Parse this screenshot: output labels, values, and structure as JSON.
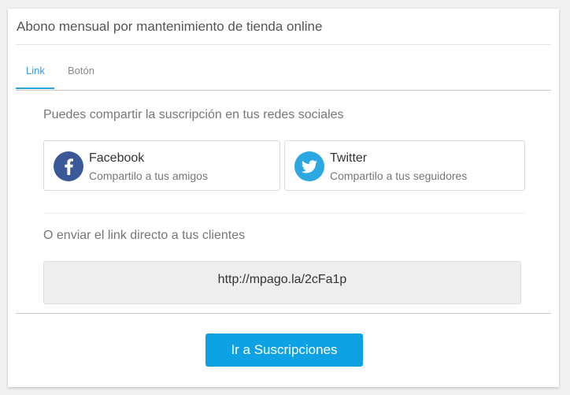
{
  "card": {
    "title": "Abono mensual por mantenimiento de tienda online"
  },
  "tabs": [
    {
      "label": "Link",
      "active": true
    },
    {
      "label": "Botón",
      "active": false
    }
  ],
  "share": {
    "heading": "Puedes compartir la suscripción en tus redes sociales",
    "facebook": {
      "name": "Facebook",
      "subtitle": "Compartilo a tus amigos",
      "icon": "facebook-icon",
      "color": "#3b5998"
    },
    "twitter": {
      "name": "Twitter",
      "subtitle": "Compartilo a tus seguidores",
      "icon": "twitter-icon",
      "color": "#2ba8e2"
    }
  },
  "direct_link": {
    "heading": "O enviar el link directo a tus clientes",
    "url": "http://mpago.la/2cFa1p"
  },
  "footer": {
    "button_label": "Ir a Suscripciones"
  },
  "colors": {
    "accent": "#2e9ee4",
    "button": "#0ea2e4"
  }
}
